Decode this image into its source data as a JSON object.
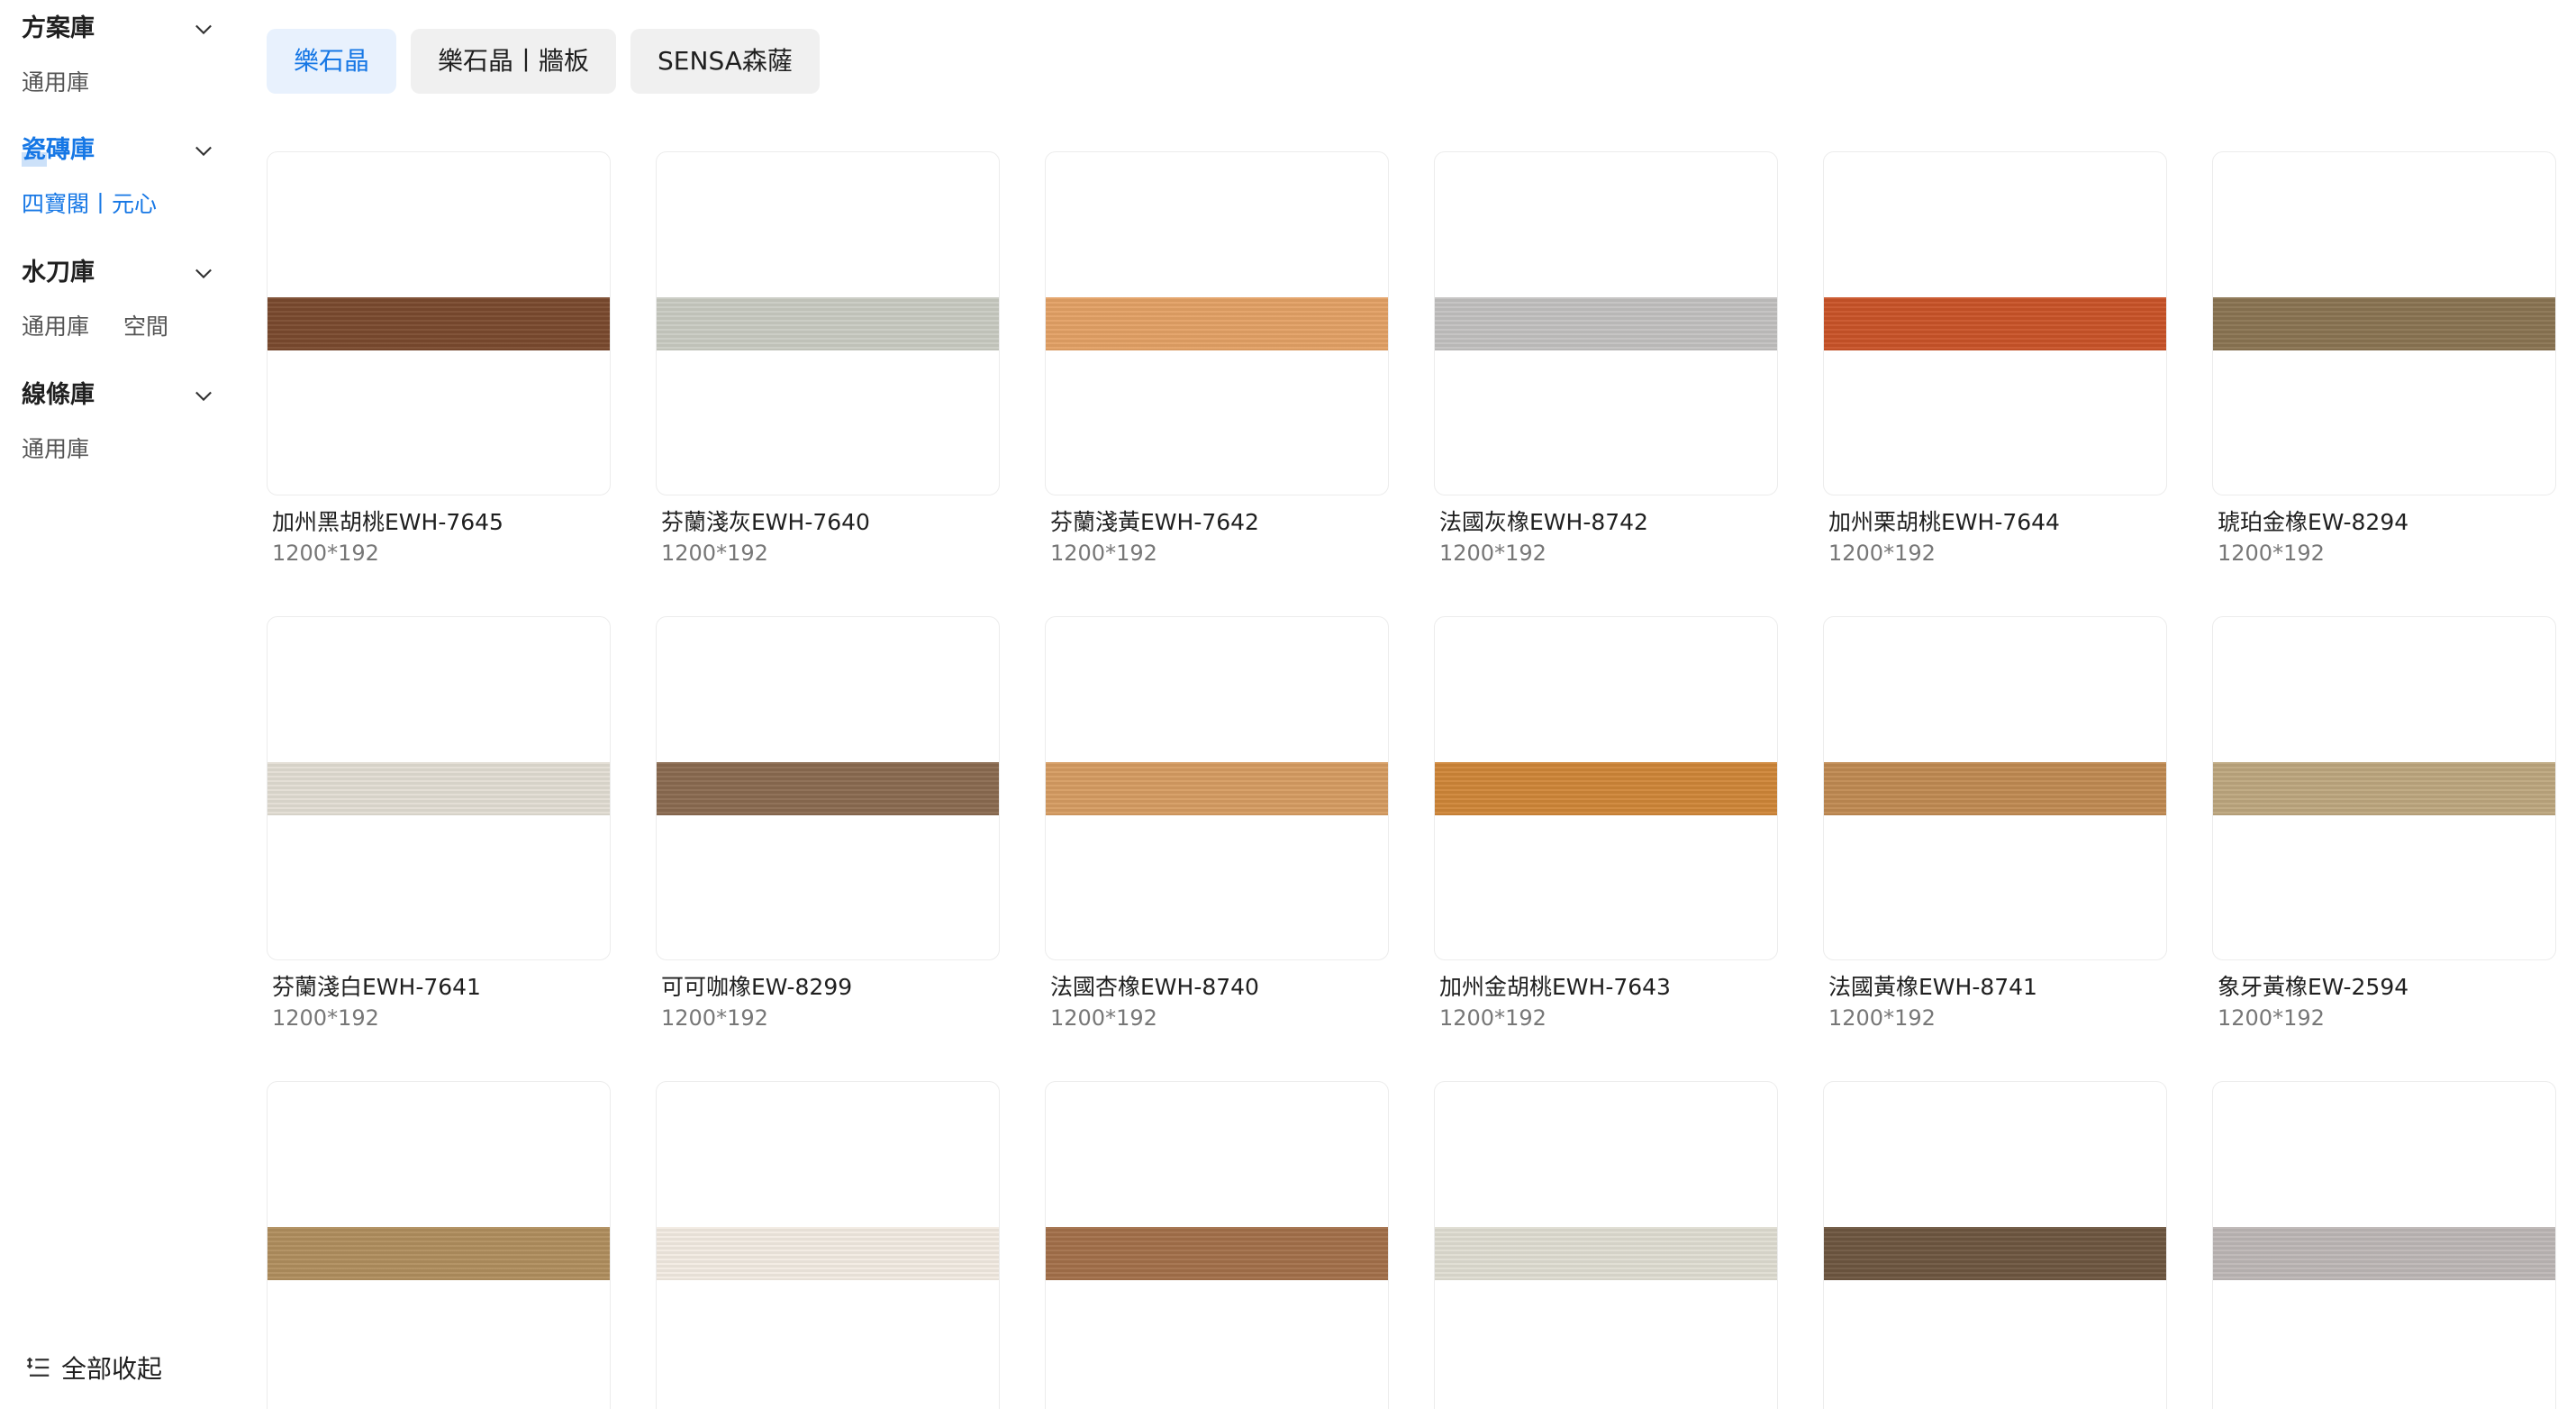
{
  "sidebar": {
    "sections": [
      {
        "title": "方案庫",
        "items": [
          "通用庫"
        ]
      },
      {
        "title": "瓷磚庫",
        "items": [
          "四寶閣丨元心"
        ]
      },
      {
        "title": "水刀庫",
        "items": [
          "通用庫",
          "空間"
        ]
      },
      {
        "title": "線條庫",
        "items": [
          "通用庫"
        ]
      }
    ],
    "active_section": "瓷磚庫",
    "active_item": "四寶閣丨元心",
    "collapse_all_label": "全部收起"
  },
  "tabs": [
    {
      "label": "樂石晶",
      "active": true
    },
    {
      "label": "樂石晶丨牆板",
      "active": false
    },
    {
      "label": "SENSA森薩",
      "active": false
    }
  ],
  "colors": {
    "accent": "#1677e5",
    "tab_active_bg": "#e8f1fd",
    "tab_bg": "#f0f0f0"
  },
  "products": [
    {
      "name": "加州黑胡桃EWH-7645",
      "size": "1200*192",
      "swatch": "#7a4a2e"
    },
    {
      "name": "芬蘭淺灰EWH-7640",
      "size": "1200*192",
      "swatch": "#c9cbc2"
    },
    {
      "name": "芬蘭淺黃EWH-7642",
      "size": "1200*192",
      "swatch": "#e3a165"
    },
    {
      "name": "法國灰橡EWH-8742",
      "size": "1200*192",
      "swatch": "#c2c1c0"
    },
    {
      "name": "加州栗胡桃EWH-7644",
      "size": "1200*192",
      "swatch": "#c95328"
    },
    {
      "name": "琥珀金橡EW-8294",
      "size": "1200*192",
      "swatch": "#8a7452"
    },
    {
      "name": "芬蘭淺白EWH-7641",
      "size": "1200*192",
      "swatch": "#e2ddd3"
    },
    {
      "name": "可可咖橡EW-8299",
      "size": "1200*192",
      "swatch": "#8a6a50"
    },
    {
      "name": "法國杏橡EWH-8740",
      "size": "1200*192",
      "swatch": "#d69c62"
    },
    {
      "name": "加州金胡桃EWH-7643",
      "size": "1200*192",
      "swatch": "#cf8638"
    },
    {
      "name": "法國黃橡EWH-8741",
      "size": "1200*192",
      "swatch": "#c08a52"
    },
    {
      "name": "象牙黃橡EW-2594",
      "size": "1200*192",
      "swatch": "#bda77e"
    },
    {
      "swatch": "#b08e5e"
    },
    {
      "swatch": "#f2ebe2"
    },
    {
      "swatch": "#a3704a"
    },
    {
      "swatch": "#dfddd2"
    },
    {
      "swatch": "#6e5640"
    },
    {
      "swatch": "#bdb7b6"
    }
  ]
}
